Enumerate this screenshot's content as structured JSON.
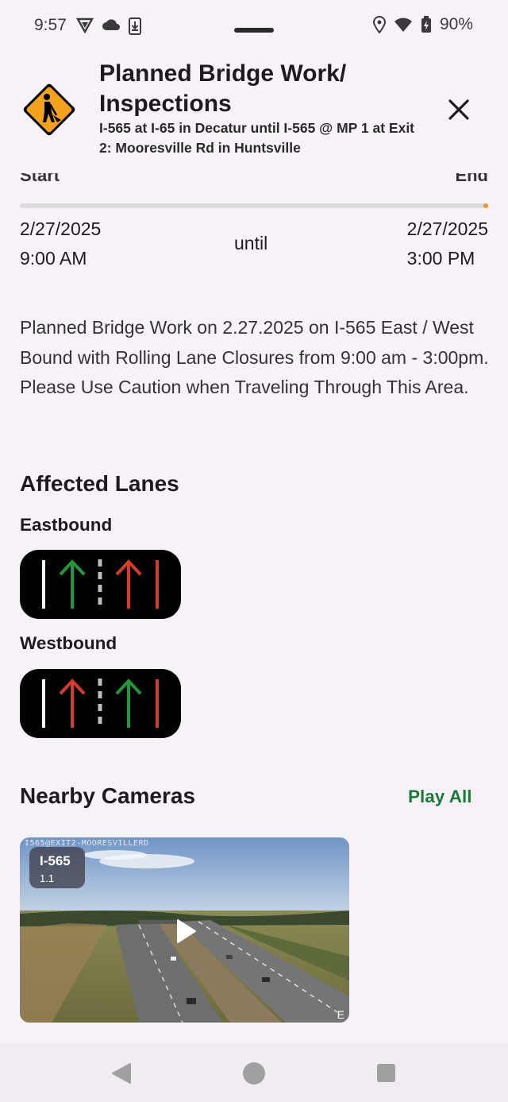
{
  "status_bar": {
    "time": "9:57",
    "battery": "90%",
    "icons_left": [
      "shield-icon",
      "cloud-icon",
      "download-icon"
    ],
    "icons_right": [
      "location-icon",
      "wifi-icon",
      "battery-icon"
    ]
  },
  "header": {
    "title": "Planned Bridge Work/ Inspections",
    "subtitle": "I-565 at I-65 in Decatur until I-565 @ MP 1 at Exit 2: Mooresville Rd in Huntsville",
    "sign_icon": "road-work-icon",
    "close_icon": "close-icon"
  },
  "timeline": {
    "start_label": "Start",
    "end_label": "End",
    "start_date": "2/27/2025",
    "start_time": "9:00 AM",
    "until": "until",
    "end_date": "2/27/2025",
    "end_time": "3:00 PM",
    "accent": "#e8962e"
  },
  "description": "Planned Bridge Work on 2.27.2025 on I-565 East / West Bound with Rolling Lane Closures from 9:00 am - 3:00pm. Please Use Caution when Traveling Through This Area.",
  "affected_lanes": {
    "title": "Affected Lanes",
    "groups": [
      {
        "direction": "Eastbound",
        "lanes": [
          "open",
          "closed"
        ]
      },
      {
        "direction": "Westbound",
        "lanes": [
          "closed",
          "open"
        ]
      }
    ],
    "colors": {
      "open": "#1e9a3c",
      "closed": "#d63b2e"
    }
  },
  "cameras": {
    "title": "Nearby Cameras",
    "play_all": "Play All",
    "items": [
      {
        "route": "I-565",
        "mile": "1.1",
        "caption": "I565@EXIT2-MOORESVILLERD",
        "direction": "E"
      }
    ]
  },
  "nav": {
    "icons": [
      "back-icon",
      "home-icon",
      "recents-icon"
    ]
  }
}
